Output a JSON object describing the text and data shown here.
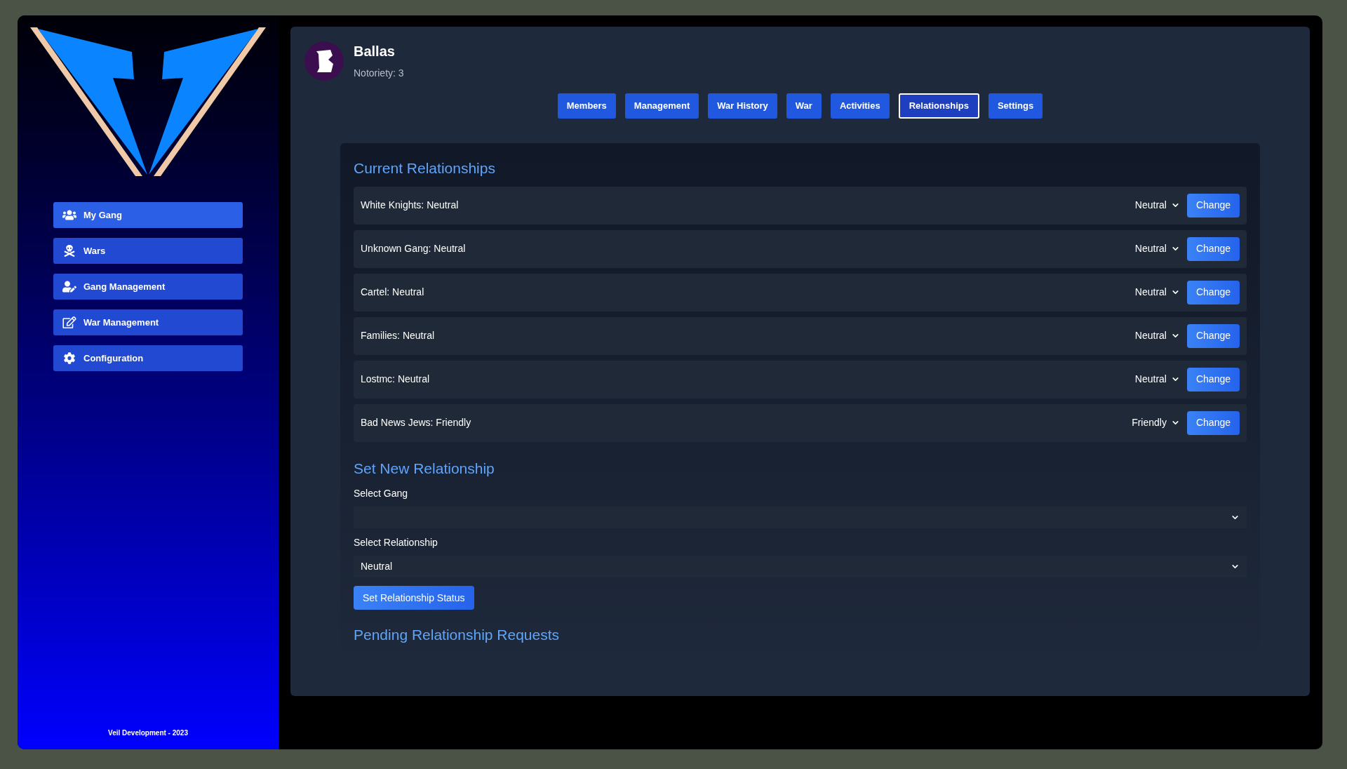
{
  "sidebar": {
    "items": [
      {
        "label": "My Gang",
        "selected": true
      },
      {
        "label": "Wars",
        "selected": false
      },
      {
        "label": "Gang Management",
        "selected": false
      },
      {
        "label": "War Management",
        "selected": false
      },
      {
        "label": "Configuration",
        "selected": false
      }
    ],
    "footer": "Veil Development - 2023"
  },
  "gang": {
    "name": "Ballas",
    "notoriety": "Notoriety: 3"
  },
  "tabs": [
    {
      "label": "Members",
      "selected": false
    },
    {
      "label": "Management",
      "selected": false
    },
    {
      "label": "War History",
      "selected": false
    },
    {
      "label": "War",
      "selected": false
    },
    {
      "label": "Activities",
      "selected": false
    },
    {
      "label": "Relationships",
      "selected": true
    },
    {
      "label": "Settings",
      "selected": false
    }
  ],
  "current": {
    "title": "Current Relationships",
    "rows": [
      {
        "label": "White Knights: Neutral",
        "status": "Neutral",
        "button": "Change"
      },
      {
        "label": "Unknown Gang: Neutral",
        "status": "Neutral",
        "button": "Change"
      },
      {
        "label": "Cartel: Neutral",
        "status": "Neutral",
        "button": "Change"
      },
      {
        "label": "Families: Neutral",
        "status": "Neutral",
        "button": "Change"
      },
      {
        "label": "Lostmc: Neutral",
        "status": "Neutral",
        "button": "Change"
      },
      {
        "label": "Bad News Jews: Friendly",
        "status": "Friendly",
        "button": "Change"
      }
    ]
  },
  "new": {
    "title": "Set New Relationship",
    "fields": [
      {
        "label": "Select Gang"
      },
      {
        "label": "Select Relationship",
        "value": "Neutral"
      }
    ],
    "button": "Set Relationship Status"
  },
  "pending": {
    "title": "Pending Relationship Requests"
  }
}
